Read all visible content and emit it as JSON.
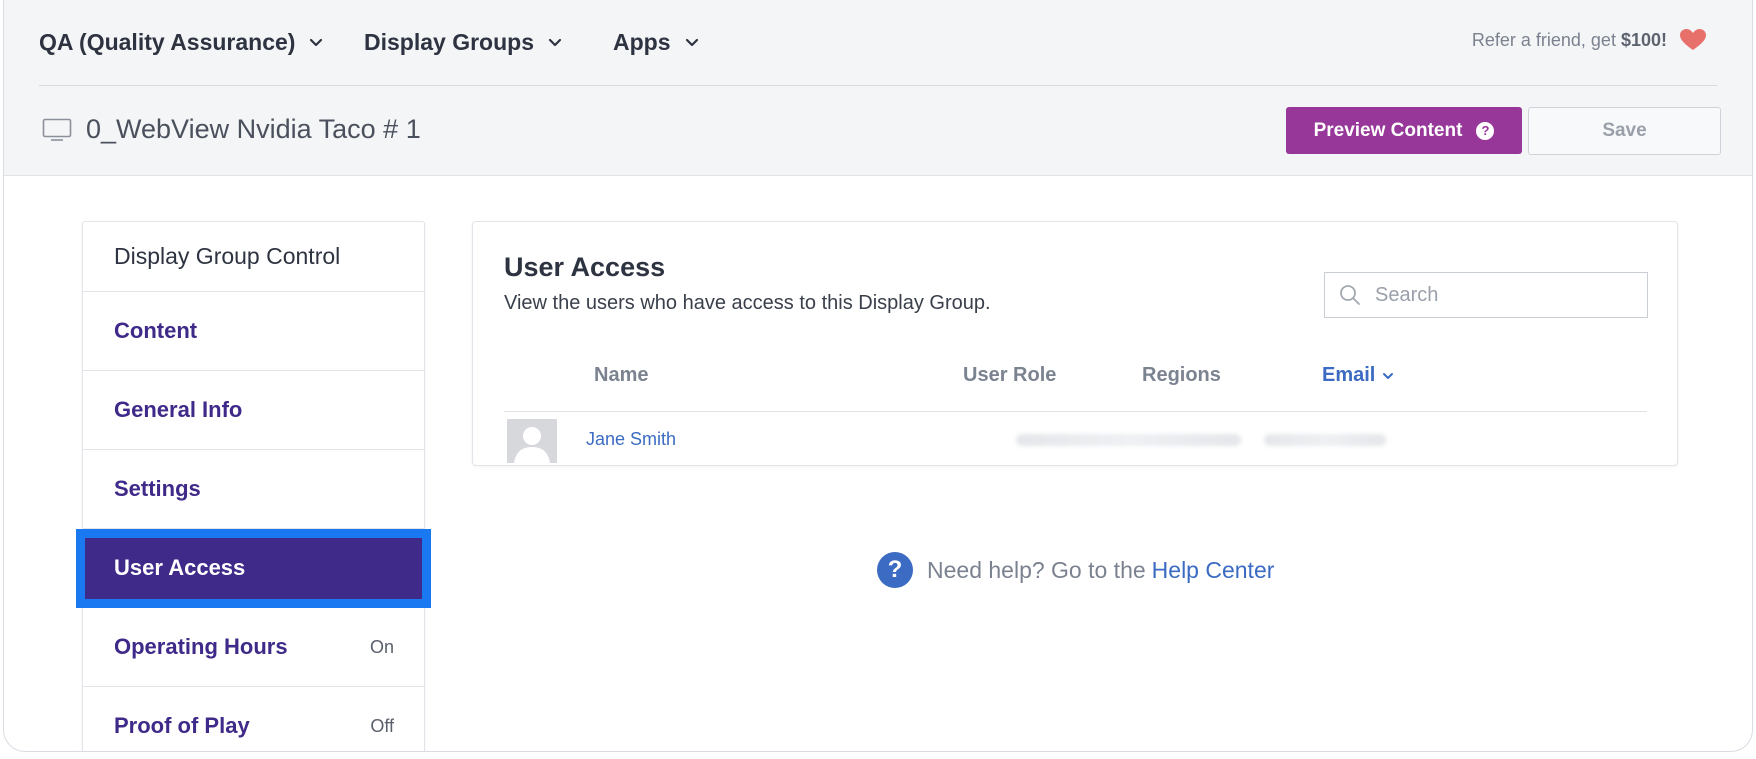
{
  "header": {
    "nav": [
      {
        "label": "QA (Quality Assurance)",
        "icon": "chevron-down-icon"
      },
      {
        "label": "Display Groups",
        "icon": "chevron-down-icon"
      },
      {
        "label": "Apps",
        "icon": "chevron-down-icon"
      }
    ],
    "refer_text": "Refer a friend, get",
    "refer_amount": "$100!",
    "refer_icon": "heart-icon",
    "display_name": "0_WebView Nvidia Taco # 1",
    "display_icon": "monitor-icon",
    "preview_label": "Preview Content",
    "save_label": "Save"
  },
  "sidebar": {
    "title": "Display Group Control",
    "items": [
      {
        "label": "Content",
        "status": ""
      },
      {
        "label": "General Info",
        "status": ""
      },
      {
        "label": "Settings",
        "status": ""
      },
      {
        "label": "User Access",
        "status": "",
        "active": true
      },
      {
        "label": "Operating Hours",
        "status": "On"
      },
      {
        "label": "Proof of Play",
        "status": "Off"
      }
    ]
  },
  "main": {
    "title": "User Access",
    "subtitle": "View the users who have access to this Display Group.",
    "search_placeholder": "Search",
    "columns": [
      "Name",
      "User Role",
      "Regions",
      "Email"
    ],
    "sorted_column": "Email",
    "rows": [
      {
        "name": "Jane Smith"
      }
    ]
  },
  "help": {
    "text": "Need help? Go to the",
    "link": "Help Center"
  },
  "colors": {
    "brand_purple": "#97379a",
    "nav_purple": "#3f2a8a",
    "highlight_blue": "#1a78f0",
    "link_blue": "#3b6bc2",
    "heart": "#e8706b"
  }
}
